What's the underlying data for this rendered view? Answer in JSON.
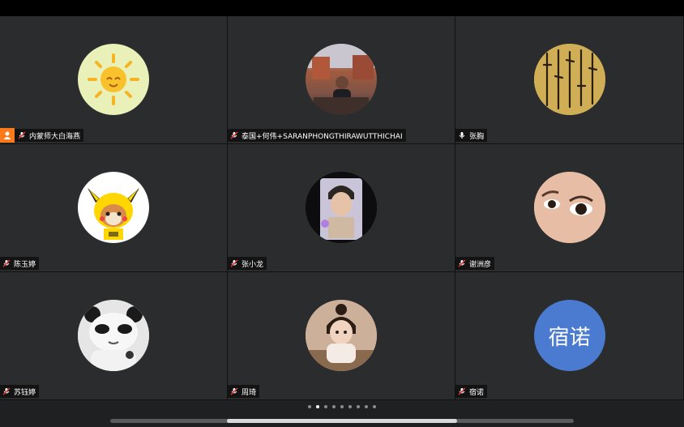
{
  "participants": [
    {
      "name": "内蒙师大白海燕",
      "is_host": true,
      "mic": "muted",
      "avatar": "sun-cartoon"
    },
    {
      "name": "泰国+何伟+SARANPHONGTHIRAWUTTHICHAI",
      "is_host": false,
      "mic": "muted",
      "avatar": "man-photo"
    },
    {
      "name": "张胸",
      "is_host": false,
      "mic": "on",
      "avatar": "calligraphy-scroll"
    },
    {
      "name": "陈玉婷",
      "is_host": false,
      "mic": "muted",
      "avatar": "pikachu-costume-dog"
    },
    {
      "name": "张小龙",
      "is_host": false,
      "mic": "muted",
      "avatar": "young-man-selfie"
    },
    {
      "name": "谢洲彦",
      "is_host": false,
      "mic": "muted",
      "avatar": "child-eye-closeup"
    },
    {
      "name": "苏钰婷",
      "is_host": false,
      "mic": "muted",
      "avatar": "panda-meme"
    },
    {
      "name": "周琦",
      "is_host": false,
      "mic": "muted",
      "avatar": "little-girl-photo"
    },
    {
      "name": "宿诺",
      "is_host": false,
      "mic": "muted",
      "avatar": "initials",
      "initials": "宿诺",
      "avatar_color": "#4a7bd0"
    }
  ],
  "pagination": {
    "total_pages": 9,
    "current_page": 2
  },
  "colors": {
    "tile_bg": "#2b2c2e",
    "host_badge": "#ff7a1a",
    "mic_muted": "#ffffff",
    "initials_bg": "#4a7bd0"
  }
}
